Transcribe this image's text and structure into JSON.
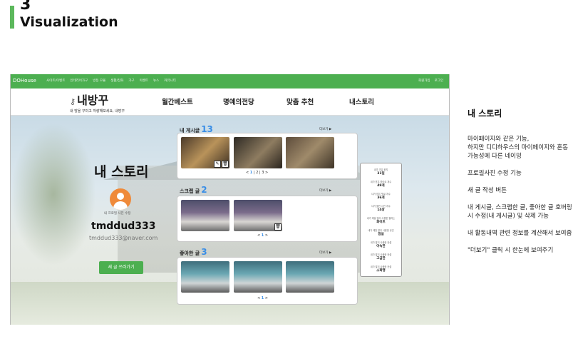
{
  "heading": {
    "number": "3",
    "title": "Visualization"
  },
  "topbar": {
    "logo": "DOHouse",
    "nav": [
      "사이트/이벤트",
      "인테리어가구",
      "방등 꾸몰",
      "생활/잡화",
      "가구",
      "이벤트",
      "뉴스",
      "커뮤니티"
    ],
    "right": [
      "회원가입",
      "로그인"
    ]
  },
  "brand": {
    "name": "내방꾸",
    "slogan": "내 방을 꾸미고 자랑해보세요, 내방꾸"
  },
  "menu": [
    "월간베스트",
    "명예의전당",
    "맞춤 추천",
    "내스토리"
  ],
  "profile": {
    "title": "내 스토리",
    "avatar_edit": "내 프로필 사진 수정",
    "username": "tmddud333",
    "email": "tmddud333@naver.com",
    "write_button": "새 글 쓰러가기"
  },
  "sections": {
    "posts": {
      "label": "내 게시글",
      "count": "13",
      "more": "더보기 ▶",
      "pager": {
        "prev": "<",
        "pages": [
          "1",
          "2",
          "3"
        ],
        "next": ">"
      }
    },
    "scraps": {
      "label": "스크랩 글",
      "count": "2",
      "more": "더보기 ▶",
      "pager": {
        "prev": "<",
        "pages": [
          "1"
        ],
        "next": ">"
      }
    },
    "likes": {
      "label": "좋아한 글",
      "count": "3",
      "more": "더보기 ▶",
      "pager": {
        "prev": "<",
        "pages": [
          "1"
        ],
        "next": ">"
      }
    }
  },
  "stats": [
    {
      "label": "내가 가입 한지",
      "value": "31일"
    },
    {
      "label": "내가 받은 좋아요 개수",
      "value": "49개"
    },
    {
      "label": "내가 받은 댓글 개수",
      "value": "36개"
    },
    {
      "label": "내가 올린 사진 개수",
      "value": "14장"
    },
    {
      "label": "내가 제일 많이 사용한 컬러는",
      "value": "화이트"
    },
    {
      "label": "내가 제일 많이 사용한 공간",
      "value": "침실"
    },
    {
      "label": "내가 많이 사용한 컨셉",
      "value": "아늑한"
    },
    {
      "label": "내가 많이 사용한 컨셉",
      "value": "고급한"
    },
    {
      "label": "내가 많이 사용한 컨셉",
      "value": "소확행"
    }
  ],
  "notes": {
    "title": "내 스토리",
    "paragraphs": [
      "마이페이지와 같은 기능,\n하지만 디디하우스의 마이페이지와 혼동 가능성에 다른 네이밍",
      "프로필사진 수정 기능",
      "새 글 작성 버튼",
      "내 게시글, 스크랩한 글, 좋아한 글 호버링시 수정(내 게시글) 및 삭제 가능",
      "내 활동내역 관련 정보를 계산해서 보여줌",
      "\"더보기\" 클릭 시 한눈에 보여주기"
    ]
  }
}
